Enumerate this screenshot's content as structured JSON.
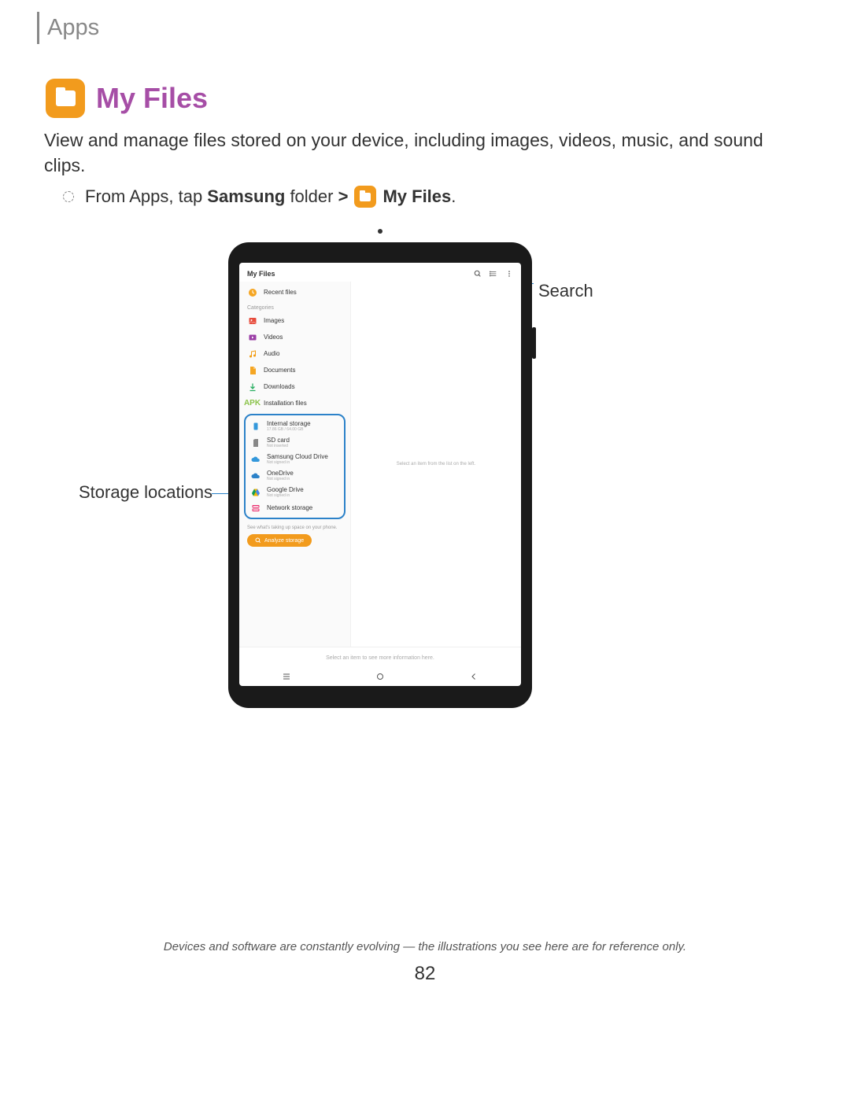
{
  "breadcrumb": "Apps",
  "section_title": "My Files",
  "description": "View and manage files stored on your device, including images, videos, music, and sound clips.",
  "instruction": {
    "prefix": "From Apps, tap ",
    "bold1": "Samsung",
    "mid": " folder ",
    "chev": ">",
    "bold2": "My Files",
    "suffix": "."
  },
  "callouts": {
    "search": "Search",
    "storage": "Storage locations"
  },
  "app": {
    "title": "My Files",
    "recent": "Recent files",
    "categories_label": "Categories",
    "categories": {
      "images": "Images",
      "videos": "Videos",
      "audio": "Audio",
      "documents": "Documents",
      "downloads": "Downloads",
      "installation": "Installation files"
    },
    "storage": {
      "internal": {
        "label": "Internal storage",
        "sub": "17.86 GB / 64.00 GB"
      },
      "sd": {
        "label": "SD card",
        "sub": "Not inserted"
      },
      "samsung_cloud": {
        "label": "Samsung Cloud Drive",
        "sub": "Not signed in"
      },
      "onedrive": {
        "label": "OneDrive",
        "sub": "Not signed in"
      },
      "gdrive": {
        "label": "Google Drive",
        "sub": "Not signed in"
      },
      "network": {
        "label": "Network storage",
        "sub": ""
      }
    },
    "analyze_hint": "See what's taking up space on your phone.",
    "analyze_btn": "Analyze storage",
    "detail_placeholder": "Select an item from the list on the left.",
    "bottom_info": "Select an item to see more information here."
  },
  "footer": "Devices and software are constantly evolving — the illustrations you see here are for reference only.",
  "page_number": "82"
}
